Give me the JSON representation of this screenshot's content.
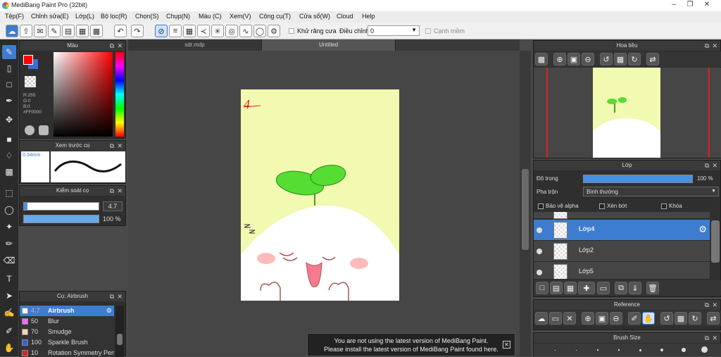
{
  "window": {
    "title": "MediBang Paint Pro (32bit)"
  },
  "menu": [
    "Tệp(F)",
    "Chỉnh sửa(E)",
    "Lớp(L)",
    "Bộ lọc(R)",
    "Chọn(S)",
    "Chụp(N)",
    "Màu (C)",
    "Xem(V)",
    "Công cụ(T)",
    "Cửa sổ(W)",
    "Cloud",
    "Help"
  ],
  "toolbar": {
    "antialias_label": "Khử răng cưa",
    "adjust_label": "Điều chỉnh",
    "adjust_value": "0",
    "smooth_label": "Cạnh mềm"
  },
  "color_panel": {
    "title": "Màu",
    "r": "R:255",
    "g": "G:0",
    "b": "B:0",
    "hex": "#FF0000",
    "fg": "#ff0000",
    "bg": "#3a6fd8"
  },
  "preview_panel": {
    "title": "Xem trước cọ",
    "size": "0.34mm"
  },
  "brush_control": {
    "title": "Kiểm soát cọ",
    "size_value": "4.7",
    "opacity_value": "100 %",
    "size_frac": 0.05,
    "opacity_frac": 1.0
  },
  "brush_list": {
    "title": "Cọ: Airbrush",
    "items": [
      {
        "size": "4.7",
        "name": "Airbrush",
        "color": "#ffffff"
      },
      {
        "size": "50",
        "name": "Blur",
        "color": "#ff66ff"
      },
      {
        "size": "70",
        "name": "Smudge",
        "color": "#f5d6b8"
      },
      {
        "size": "100",
        "name": "Sparkle Brush",
        "color": "#3a5fd8"
      },
      {
        "size": "10",
        "name": "Rotation Symmetry Pen",
        "color": "#e02020"
      }
    ]
  },
  "tabs": [
    "sdr.mdp",
    "Untitled"
  ],
  "navigator": {
    "title": "Hoa tiêu"
  },
  "layer_panel": {
    "title": "Lớp",
    "opacity_label": "Độ trong",
    "opacity_value": "100 %",
    "opacity_frac": 1.0,
    "blend_label": "Pha trộn",
    "blend_value": "Bình thường",
    "protect_alpha": "Bảo vệ alpha",
    "clipping": "Xén bớt",
    "lock": "Khóa",
    "layers": [
      "Lớp4",
      "Lớp2",
      "Lớp5"
    ]
  },
  "reference": {
    "title": "Reference"
  },
  "brush_size": {
    "title": "Brush Size"
  },
  "notice": {
    "line1": "You are not using the latest version of MediBang Paint.",
    "line2": "Please install the latest version of MediBang Paint found here."
  },
  "canvas": {
    "bg": "#f2f9b0",
    "scribble": "4"
  }
}
